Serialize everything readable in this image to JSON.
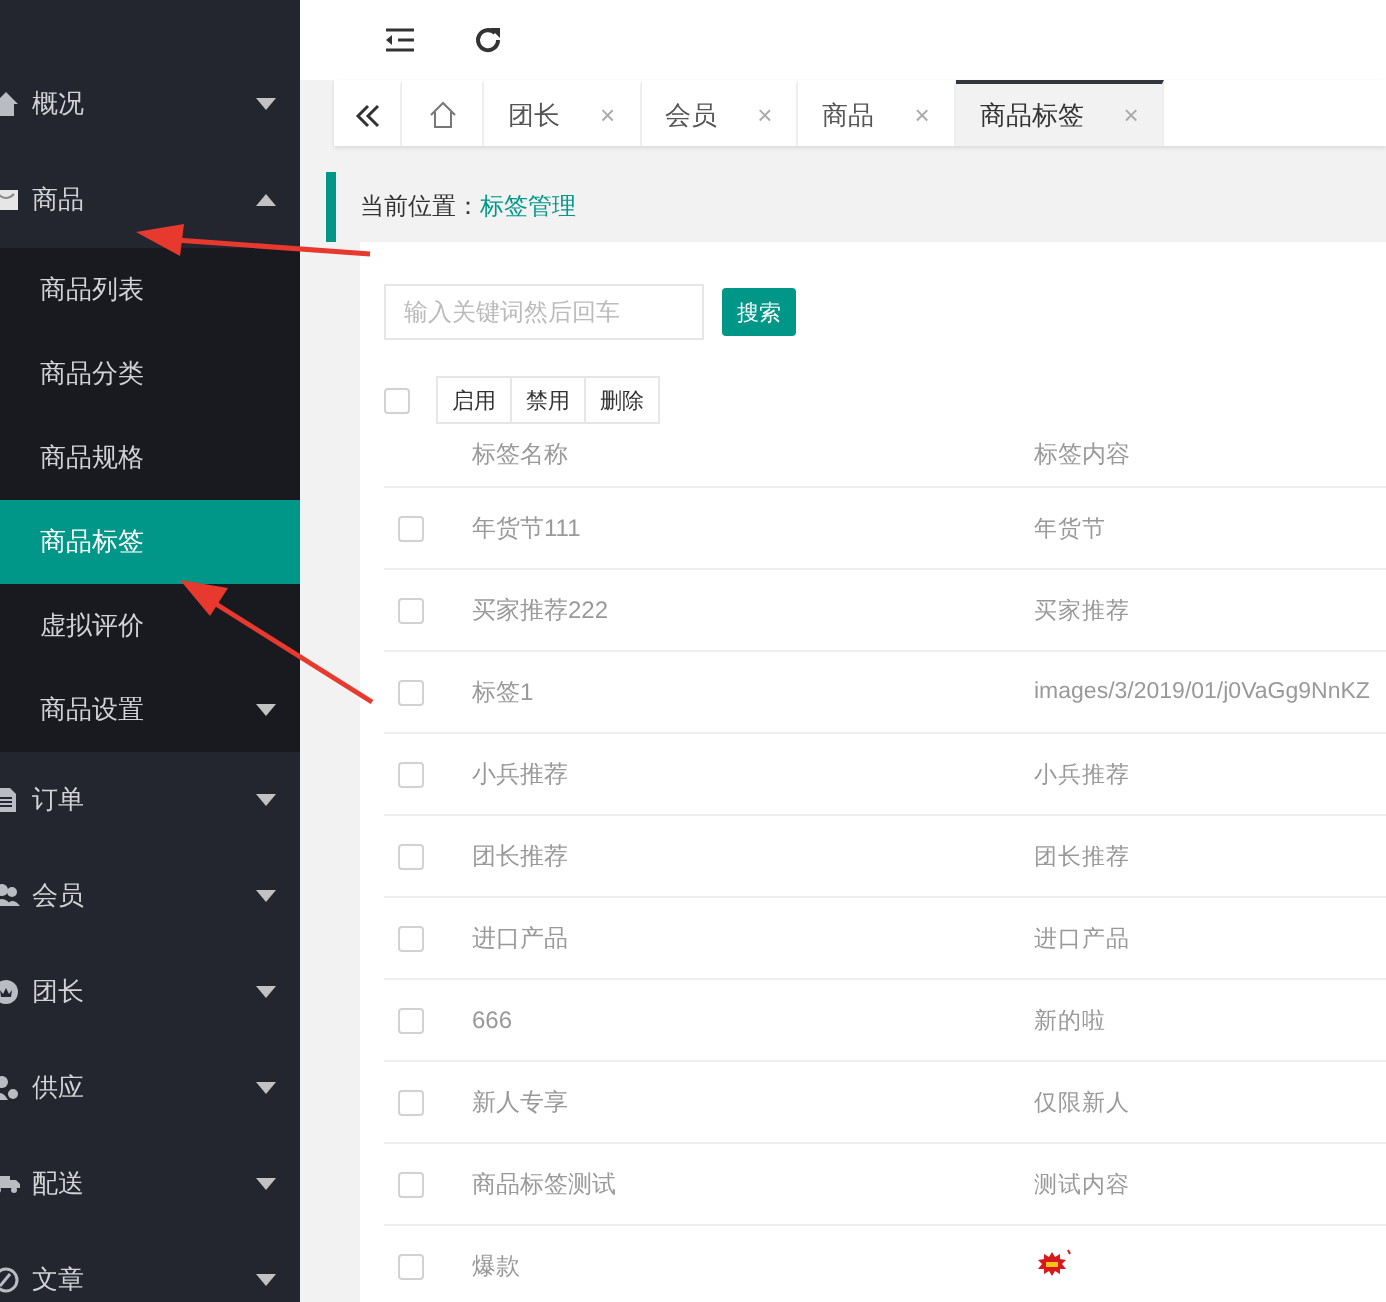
{
  "sidebar": {
    "items": [
      {
        "label": "概况",
        "expanded": false
      },
      {
        "label": "商品",
        "expanded": true,
        "children": [
          {
            "label": "商品列表",
            "selected": false
          },
          {
            "label": "商品分类",
            "selected": false
          },
          {
            "label": "商品规格",
            "selected": false
          },
          {
            "label": "商品标签",
            "selected": true
          },
          {
            "label": "虚拟评价",
            "selected": false
          },
          {
            "label": "商品设置",
            "selected": false,
            "has_menu": true
          }
        ]
      },
      {
        "label": "订单",
        "expanded": false
      },
      {
        "label": "会员",
        "expanded": false
      },
      {
        "label": "团长",
        "expanded": false
      },
      {
        "label": "供应",
        "expanded": false
      },
      {
        "label": "配送",
        "expanded": false
      },
      {
        "label": "文章",
        "expanded": false
      }
    ]
  },
  "tabs": [
    {
      "label": "团长",
      "selected": false,
      "close": "×"
    },
    {
      "label": "会员",
      "selected": false,
      "close": "×"
    },
    {
      "label": "商品",
      "selected": false,
      "close": "×"
    },
    {
      "label": "商品标签",
      "selected": true,
      "close": "×"
    }
  ],
  "breadcrumb": {
    "label": "当前位置：",
    "current": "标签管理"
  },
  "search": {
    "placeholder": "输入关键词然后回车",
    "button": "搜索"
  },
  "toolbar": {
    "select_all_checked": false,
    "buttons": [
      "启用",
      "禁用",
      "删除"
    ]
  },
  "table": {
    "columns": [
      "标签名称",
      "标签内容"
    ],
    "rows": [
      {
        "checked": false,
        "name": "年货节111",
        "kind": "text",
        "content": "年货节"
      },
      {
        "checked": false,
        "name": "买家推荐222",
        "kind": "text",
        "content": "买家推荐"
      },
      {
        "checked": false,
        "name": "标签1",
        "kind": "text",
        "content": "images/3/2019/01/j0VaGg9NnKZ"
      },
      {
        "checked": false,
        "name": "小兵推荐",
        "kind": "text",
        "content": "小兵推荐"
      },
      {
        "checked": false,
        "name": "团长推荐",
        "kind": "text",
        "content": "团长推荐"
      },
      {
        "checked": false,
        "name": "进口产品",
        "kind": "text",
        "content": "进口产品"
      },
      {
        "checked": false,
        "name": "666",
        "kind": "text",
        "content": "新的啦"
      },
      {
        "checked": false,
        "name": "新人专享",
        "kind": "text",
        "content": "仅限新人"
      },
      {
        "checked": false,
        "name": "商品标签测试",
        "kind": "text",
        "content": "测试内容"
      },
      {
        "checked": false,
        "name": "爆款",
        "kind": "sticker"
      }
    ]
  }
}
